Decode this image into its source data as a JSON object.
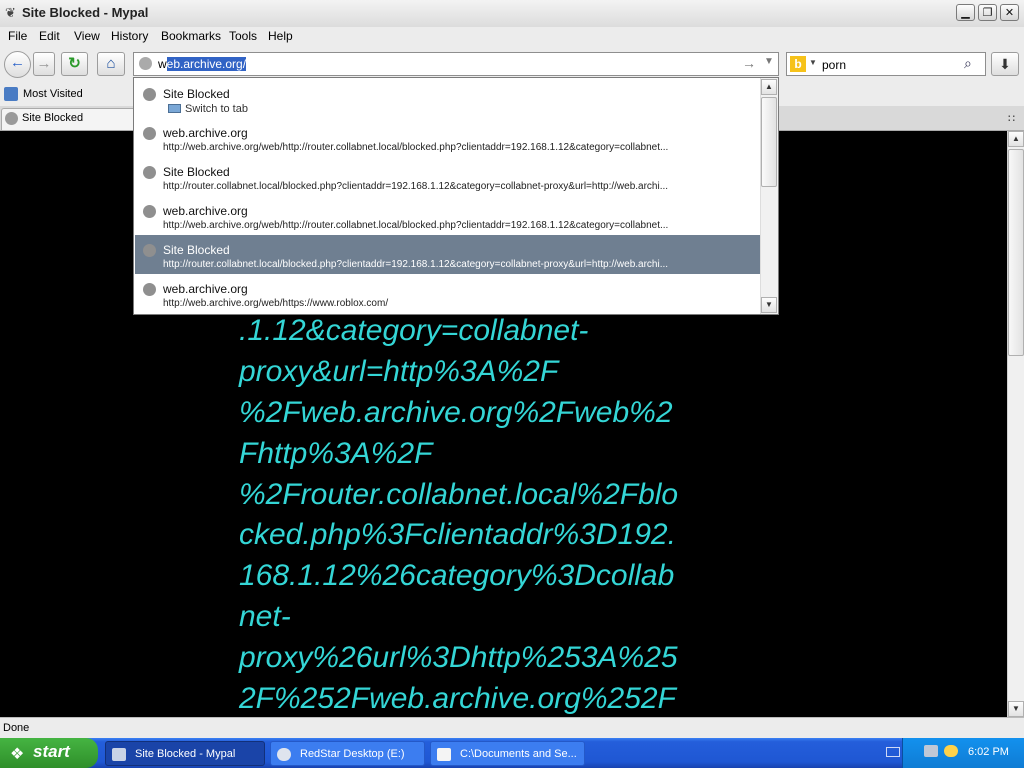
{
  "window": {
    "title": "Site Blocked - Mypal"
  },
  "menu": [
    "File",
    "Edit",
    "View",
    "History",
    "Bookmarks",
    "Tools",
    "Help"
  ],
  "urlbar": {
    "typed": "w",
    "selected": "eb.archive.org/"
  },
  "search": {
    "query": "porn"
  },
  "bookmarks": {
    "most_visited": "Most Visited"
  },
  "tab": {
    "label": "Site Blocked"
  },
  "autocomplete": [
    {
      "title": "Site Blocked",
      "sub": "Switch to tab",
      "type": "switch"
    },
    {
      "title": "web.archive.org",
      "url": "http://web.archive.org/web/http://router.collabnet.local/blocked.php?clientaddr=192.168.1.12&category=collabnet..."
    },
    {
      "title": "Site Blocked",
      "url": "http://router.collabnet.local/blocked.php?clientaddr=192.168.1.12&category=collabnet-proxy&url=http://web.archi..."
    },
    {
      "title": "web.archive.org",
      "url": "http://web.archive.org/web/http://router.collabnet.local/blocked.php?clientaddr=192.168.1.12&category=collabnet..."
    },
    {
      "title": "Site Blocked",
      "url": "http://router.collabnet.local/blocked.php?clientaddr=192.168.1.12&category=collabnet-proxy&url=http://web.archi...",
      "selected": true
    },
    {
      "title": "web.archive.org",
      "url": "http://web.archive.org/web/https://www.roblox.com/"
    }
  ],
  "content": {
    "lines": [
      ".1.12&category=collabnet-",
      "proxy&url=http%3A%2F",
      "%2Fweb.archive.org%2Fweb%2",
      "Fhttp%3A%2F",
      "%2Frouter.collabnet.local%2Fblo",
      "cked.php%3Fclientaddr%3D192.",
      "168.1.12%26category%3Dcollab",
      "net-",
      "proxy%26url%3Dhttp%253A%25",
      "2F%252Fweb.archive.org%252F"
    ],
    "color": "#34d6d6"
  },
  "status": "Done",
  "taskbar": {
    "start": "start",
    "tasks": [
      "Site Blocked - Mypal",
      "RedStar Desktop (E:)",
      "C:\\Documents and Se..."
    ],
    "clock": "6:02 PM"
  },
  "icons": [
    "globe-icon",
    "back-arrow-icon",
    "forward-arrow-icon",
    "reload-icon",
    "home-icon",
    "search-icon",
    "download-icon",
    "windows-flag-icon"
  ]
}
